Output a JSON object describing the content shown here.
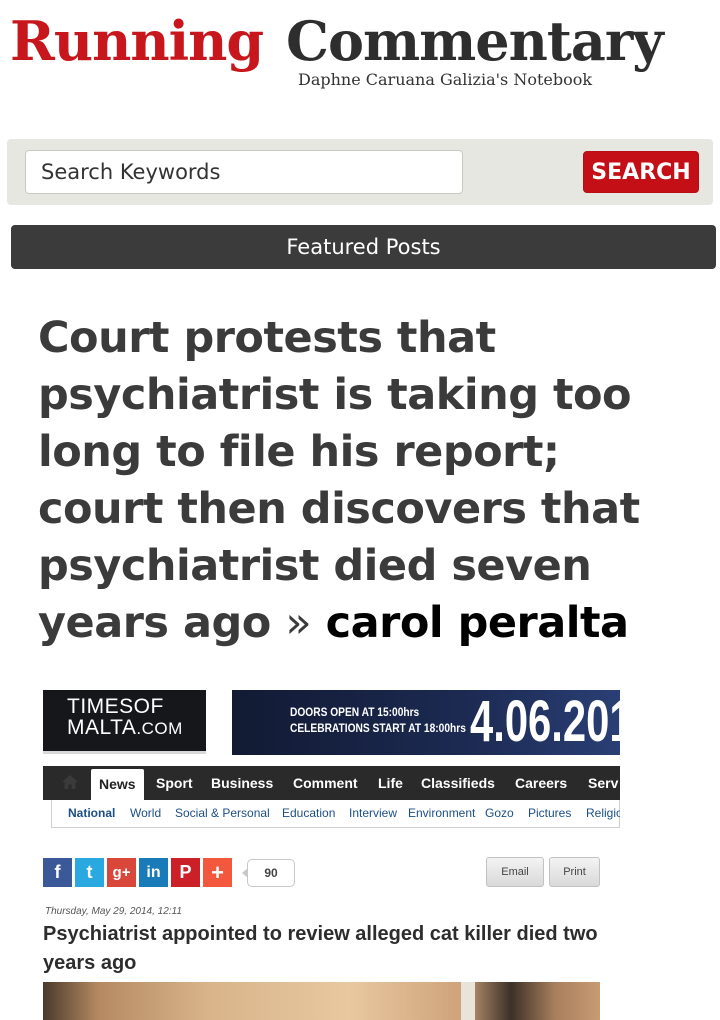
{
  "masthead": {
    "logo_word1": "Running",
    "logo_word2": "Commentary",
    "tagline": "Daphne Caruana Galizia's Notebook"
  },
  "search": {
    "placeholder": "Search Keywords",
    "button_label": "SEARCH"
  },
  "featured": {
    "label": "Featured Posts"
  },
  "headline": {
    "text": "Court protests that psychiatrist is taking too long to file his report; court then discovers that psychiatrist died seven years ago",
    "separator": "»",
    "author": "carol peralta"
  },
  "screenshot": {
    "logo_line1": "TIMESOF",
    "logo_line2_main": "MALTA",
    "logo_line2_suffix": ".COM",
    "promo_doors": "DOORS OPEN AT 15:00hrs",
    "promo_celebrations": "CELEBRATIONS START AT 18:00hrs",
    "promo_date": "4.06.201",
    "nav_items": [
      "News",
      "Sport",
      "Business",
      "Comment",
      "Life",
      "Classifieds",
      "Careers",
      "Serv"
    ],
    "subnav_items": [
      "National",
      "World",
      "Social & Personal",
      "Education",
      "Interview",
      "Environment",
      "Gozo",
      "Pictures",
      "Religio"
    ],
    "social_icons": [
      {
        "name": "facebook-icon",
        "glyph": "f",
        "color": "#3b5998"
      },
      {
        "name": "twitter-icon",
        "glyph": "t",
        "color": "#2aa9e0"
      },
      {
        "name": "googleplus-icon",
        "glyph": "g+",
        "color": "#d9463a"
      },
      {
        "name": "linkedin-icon",
        "glyph": "in",
        "color": "#1a7bb9"
      },
      {
        "name": "pinterest-icon",
        "glyph": "P",
        "color": "#cb2027"
      },
      {
        "name": "addthis-icon",
        "glyph": "+",
        "color": "#f3583e"
      }
    ],
    "share_count": "90",
    "email_label": "Email",
    "print_label": "Print",
    "article_date": "Thursday, May 29, 2014, 12:11",
    "article_title": "Psychiatrist appointed to review alleged cat killer died two years ago"
  },
  "colors": {
    "brand_red": "#c8161d",
    "logo_dark": "#2e2e2e",
    "featured_bar": "#3b3b3b",
    "search_button": "#c40f16"
  }
}
